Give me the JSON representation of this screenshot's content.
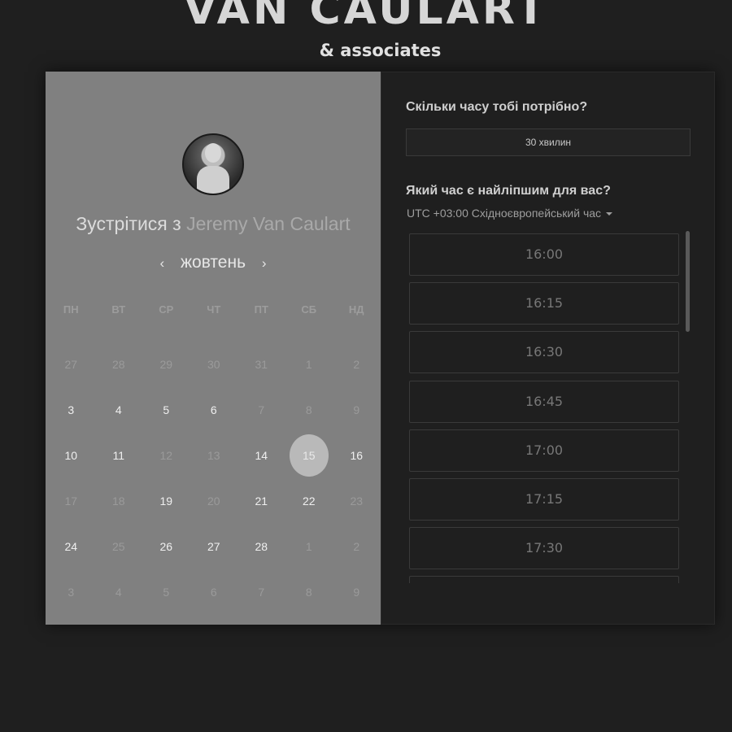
{
  "brand": {
    "title": "VAN CAULART",
    "subtitle": "& associates"
  },
  "left": {
    "meet_prefix": "Зустрітися з",
    "meet_name": "Jeremy Van Caulart",
    "month": "жовтень",
    "prev_icon": "‹",
    "next_icon": "›",
    "weekdays": [
      "ПН",
      "ВТ",
      "СР",
      "ЧТ",
      "ПТ",
      "СБ",
      "НД"
    ],
    "weeks": [
      [
        {
          "d": "27",
          "a": false
        },
        {
          "d": "28",
          "a": false
        },
        {
          "d": "29",
          "a": false
        },
        {
          "d": "30",
          "a": false
        },
        {
          "d": "31",
          "a": false
        },
        {
          "d": "1",
          "a": false
        },
        {
          "d": "2",
          "a": false
        }
      ],
      [
        {
          "d": "3",
          "a": true
        },
        {
          "d": "4",
          "a": true
        },
        {
          "d": "5",
          "a": true
        },
        {
          "d": "6",
          "a": true
        },
        {
          "d": "7",
          "a": false
        },
        {
          "d": "8",
          "a": false
        },
        {
          "d": "9",
          "a": false
        }
      ],
      [
        {
          "d": "10",
          "a": true
        },
        {
          "d": "11",
          "a": true
        },
        {
          "d": "12",
          "a": false
        },
        {
          "d": "13",
          "a": false
        },
        {
          "d": "14",
          "a": true
        },
        {
          "d": "15",
          "a": true,
          "s": true
        },
        {
          "d": "16",
          "a": true
        }
      ],
      [
        {
          "d": "17",
          "a": false
        },
        {
          "d": "18",
          "a": false
        },
        {
          "d": "19",
          "a": true
        },
        {
          "d": "20",
          "a": false
        },
        {
          "d": "21",
          "a": true
        },
        {
          "d": "22",
          "a": true
        },
        {
          "d": "23",
          "a": false
        }
      ],
      [
        {
          "d": "24",
          "a": true
        },
        {
          "d": "25",
          "a": false
        },
        {
          "d": "26",
          "a": true
        },
        {
          "d": "27",
          "a": true
        },
        {
          "d": "28",
          "a": true
        },
        {
          "d": "1",
          "a": false
        },
        {
          "d": "2",
          "a": false
        }
      ],
      [
        {
          "d": "3",
          "a": false
        },
        {
          "d": "4",
          "a": false
        },
        {
          "d": "5",
          "a": false
        },
        {
          "d": "6",
          "a": false
        },
        {
          "d": "7",
          "a": false
        },
        {
          "d": "8",
          "a": false
        },
        {
          "d": "9",
          "a": false
        }
      ]
    ]
  },
  "right": {
    "duration_question": "Скільки часу тобі потрібно?",
    "duration_value": "30 хвилин",
    "time_question": "Який час є найліпшим для вас?",
    "timezone": "UTC +03:00 Східноєвропейський час",
    "slots": [
      "16:00",
      "16:15",
      "16:30",
      "16:45",
      "17:00",
      "17:15",
      "17:30",
      ""
    ]
  },
  "colors": {
    "background": "#1f1f1f",
    "left_panel": "#808080",
    "selected_day": "#b9b9b9"
  }
}
